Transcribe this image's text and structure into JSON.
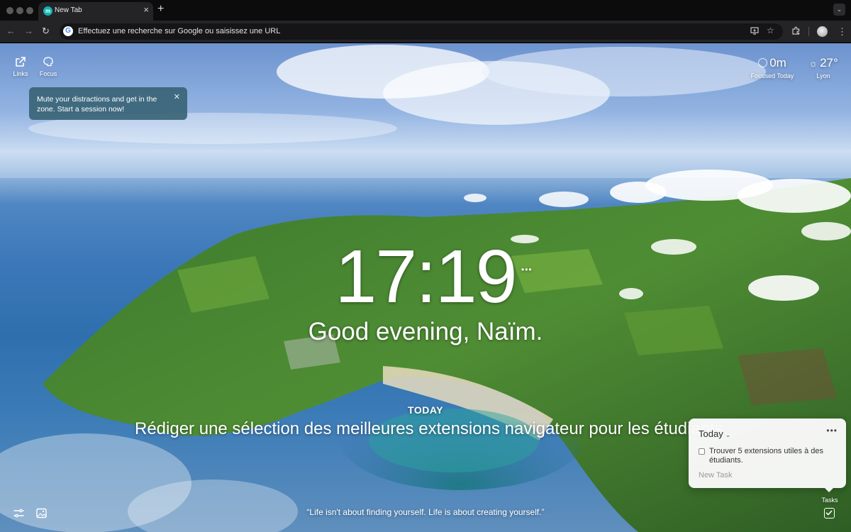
{
  "browser": {
    "tab_title": "New Tab",
    "tab_favicon_letter": "m",
    "omnibox_text": "Effectuez une recherche sur Google ou saisissez une URL",
    "google_letter": "G"
  },
  "top_left": {
    "links_label": "Links",
    "focus_label": "Focus"
  },
  "tooltip": {
    "text": "Mute your distractions and get in the zone. Start a session now!"
  },
  "focus_metric": {
    "value": "0m",
    "label": "Focused Today"
  },
  "weather": {
    "temperature": "27°",
    "location": "Lyon"
  },
  "clock": {
    "time": "17:19",
    "more": "•••"
  },
  "greeting": "Good evening, Naïm.",
  "today": {
    "label": "TODAY",
    "focus_task": "Rédiger une sélection des meilleures extensions navigateur pour les étudiants"
  },
  "quote": "“Life isn't about finding yourself. Life is about creating yourself.”",
  "tasks": {
    "list_name": "Today",
    "more": "•••",
    "items": [
      {
        "text": "Trouver 5 extensions utiles à des étudiants.",
        "done": false
      }
    ],
    "new_task_placeholder": "New Task",
    "toggle_label": "Tasks"
  },
  "icons": {
    "back": "back-arrow-icon",
    "forward": "forward-arrow-icon",
    "reload": "reload-icon",
    "install": "install-app-icon",
    "bookmark": "star-icon",
    "extensions": "puzzle-icon",
    "menu": "kebab-menu-icon",
    "links": "external-link-icon",
    "focus": "brain-icon",
    "settings": "sliders-icon",
    "photo": "image-icon",
    "tasks": "checkbox-icon"
  }
}
